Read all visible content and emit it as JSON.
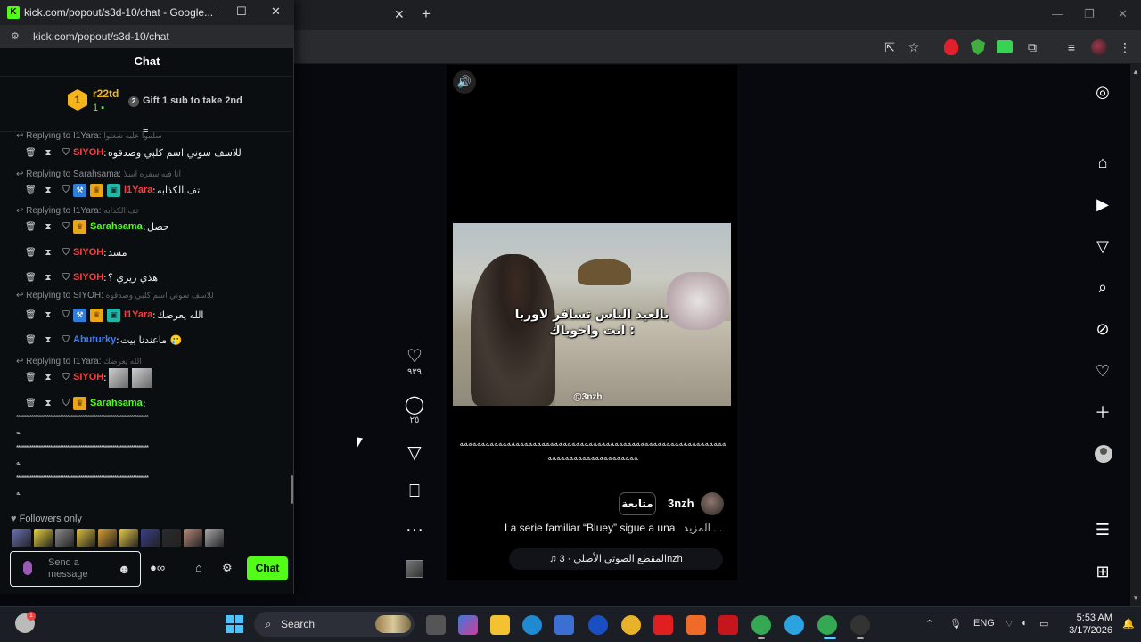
{
  "popup": {
    "window_title": "kick.com/popout/s3d-10/chat - Google...",
    "url": "kick.com/popout/s3d-10/chat",
    "chat_title": "Chat",
    "leaderboard": {
      "rank": "1",
      "name": "r22td",
      "count": "1",
      "gift_text": "Gift 1 sub to take 2nd",
      "gift_icon_text": "2"
    },
    "messages": [
      {
        "reply_to": "Replying to I1Yara:",
        "reply_quote": "سلموا عليه شغتوا",
        "user": "SIYOH",
        "color": "#ff3b3b",
        "text": "للاسف سوني اسم كلبي وصدقوه",
        "badges": []
      },
      {
        "reply_to": "Replying to Sarahsama:",
        "reply_quote": "انا فيه سفره اسلا",
        "user": "I1Yara",
        "color": "#ff3b3b",
        "text": "تف الكذابه",
        "badges": [
          "blue",
          "gold",
          "teal"
        ]
      },
      {
        "reply_to": "Replying to I1Yara:",
        "reply_quote": "تف الكذابه",
        "user": "Sarahsama",
        "color": "#53fc18",
        "text": "حصل",
        "badges": [
          "gold"
        ]
      },
      {
        "reply_to": "",
        "reply_quote": "",
        "user": "SIYOH",
        "color": "#ff3b3b",
        "text": "مسد",
        "badges": []
      },
      {
        "reply_to": "",
        "reply_quote": "",
        "user": "SIYOH",
        "color": "#ff3b3b",
        "text": "هذي ريري ؟",
        "badges": []
      },
      {
        "reply_to": "Replying to SIYOH:",
        "reply_quote": "للاسف سوني اسم كلبي وصدقوه",
        "user": "I1Yara",
        "color": "#ff3b3b",
        "text": "الله يعرضك",
        "badges": [
          "blue",
          "gold",
          "teal"
        ]
      },
      {
        "reply_to": "",
        "reply_quote": "",
        "user": "Abuturky",
        "color": "#3f7df4",
        "text": "ماعندنا بيت 🥲",
        "badges": []
      },
      {
        "reply_to": "Replying to I1Yara:",
        "reply_quote": "الله يعرضك",
        "user": "SIYOH",
        "color": "#ff3b3b",
        "text": "",
        "badges": []
      },
      {
        "reply_to": "",
        "reply_quote": "",
        "user": "Sarahsama",
        "color": "#53fc18",
        "text": "",
        "badges": [
          "gold"
        ]
      }
    ],
    "glyph_line": "**********************************************************************",
    "glyph_end": "ﻪ",
    "followers_only": "Followers only",
    "input_placeholder": "Send a message",
    "chat_button": "Chat"
  },
  "icons": {
    "trash": "🗑",
    "timeout": "⧗",
    "shield": "⛉"
  },
  "video": {
    "caption_line1": "بالعيد الناس تسافر لاوربا",
    "caption_line2": "انت واخوياك :",
    "watermark": "@3nzh",
    "like_count": "٩٣٩",
    "comment_count": "٢٥",
    "post_glyphs": "ﻪﻪﻪﻪﻪﻪﻪﻪﻪﻪﻪﻪﻪﻪﻪﻪﻪﻪﻪﻪﻪﻪﻪﻪﻪﻪﻪﻪﻪﻪﻪﻪﻪﻪﻪﻪﻪﻪﻪﻪﻪﻪﻪﻪﻪﻪﻪﻪﻪﻪﻪﻪﻪﻪﻪﻪﻪﻪﻪﻪﻪﻪ",
    "post_glyphs2": "ﻪﻪﻪﻪﻪﻪﻪﻪﻪﻪﻪﻪﻪﻪﻪﻪﻪﻪﻪﻪﻪ",
    "follow_label": "متابعة",
    "author": "3nzh",
    "more_label": "المزيد ...",
    "description": "La serie familiar “Bluey” sigue a una",
    "audio": "♫ المقطع الصوتي الأصلي · 3nzh"
  },
  "taskbar": {
    "search_label": "Search",
    "lang": "ENG",
    "time": "5:53 AM",
    "date": "3/17/2026",
    "weather_badge": "1"
  },
  "colors": {
    "kick_green": "#53fc18",
    "accent_gold": "#f5b41b"
  }
}
